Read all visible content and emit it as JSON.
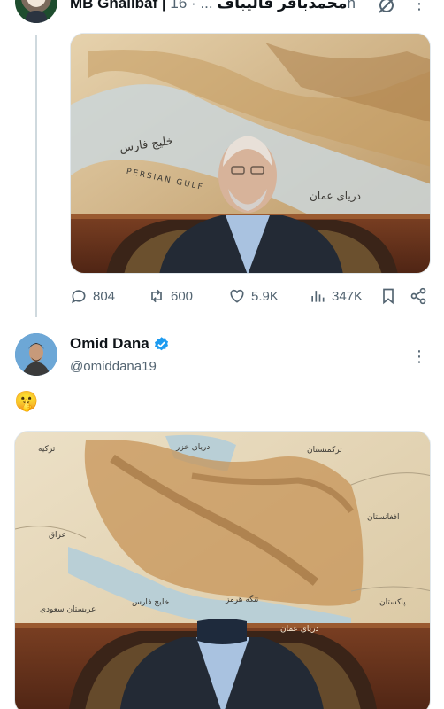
{
  "tweet1": {
    "author_name": "MB Ghalibaf | محمدباقر قالیباف",
    "ellipsis": "...",
    "separator": "·",
    "time": "16h",
    "photo_labels": {
      "persian_gulf_fa": "خلیج فارس",
      "persian_gulf_en": "PERSIAN GULF",
      "sea_of_oman": "دریای عمان"
    },
    "actions": {
      "replies": "804",
      "retweets": "600",
      "likes": "5.9K",
      "views": "347K"
    }
  },
  "tweet2": {
    "author_name": "Omid Dana",
    "handle": "@omiddana19",
    "text": "🤫",
    "photo_labels": {
      "turkey": "ترکیه",
      "caspian": "دریای خزر",
      "turkmenistan": "ترکمنستان",
      "iraq": "عراق",
      "afghanistan": "افغانستان",
      "saudi": "عربستان سعودی",
      "persian_gulf": "خلیج فارس",
      "hormuz": "تنگه هرمز",
      "pakistan": "پاکستان",
      "sea_of_oman": "دریای عمان"
    }
  },
  "colors": {
    "text": "#0f1419",
    "secondary": "#536471",
    "verified": "#1d9bf0",
    "thread_line": "#cfd9de"
  }
}
